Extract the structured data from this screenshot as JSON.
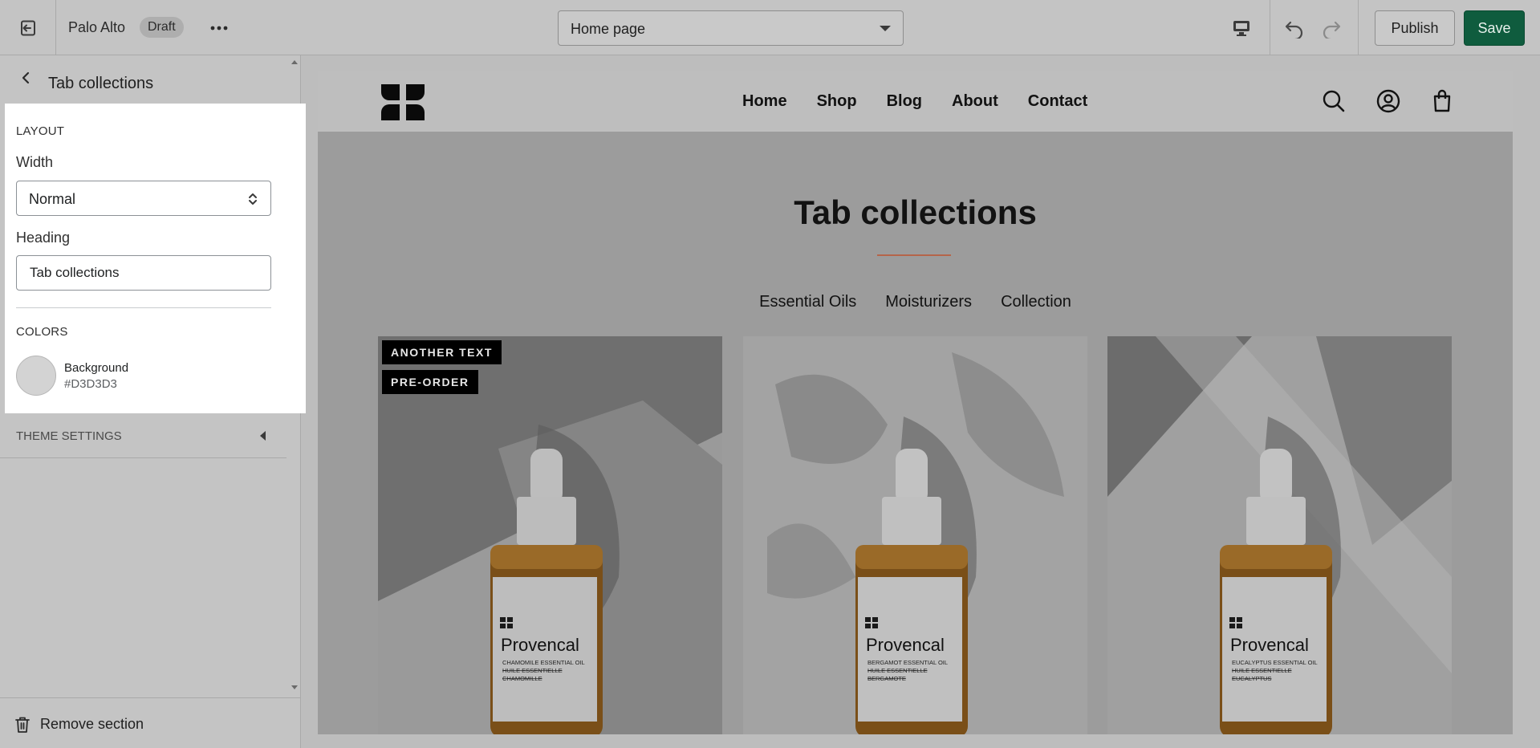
{
  "topbar": {
    "store_name": "Palo Alto",
    "status_badge": "Draft",
    "more_label": "•••",
    "page_selector": "Home page",
    "publish_label": "Publish",
    "save_label": "Save"
  },
  "sidebar": {
    "title": "Tab collections",
    "layout": {
      "section_label": "LAYOUT",
      "width_label": "Width",
      "width_value": "Normal",
      "heading_label": "Heading",
      "heading_value": "Tab collections"
    },
    "colors": {
      "section_label": "COLORS",
      "background_label": "Background",
      "background_value": "#D3D3D3"
    },
    "theme_settings_label": "THEME SETTINGS",
    "remove_label": "Remove section"
  },
  "preview": {
    "nav": [
      "Home",
      "Shop",
      "Blog",
      "About",
      "Contact"
    ],
    "section_title": "Tab collections",
    "tabs": [
      "Essential Oils",
      "Moisturizers",
      "Collection"
    ],
    "products": [
      {
        "brand": "Provencal",
        "line1": "CHAMOMILE ESSENTIAL OIL",
        "line2": "HUILE ESSENTIELLE",
        "line3": "CHAMOMILLE",
        "badges": [
          "ANOTHER TEXT",
          "PRE-ORDER"
        ]
      },
      {
        "brand": "Provencal",
        "line1": "BERGAMOT ESSENTIAL OIL",
        "line2": "HUILE ESSENTIELLE",
        "line3": "BERGAMOTE",
        "badges": []
      },
      {
        "brand": "Provencal",
        "line1": "EUCALYPTUS ESSENTIAL OIL",
        "line2": "HUILE ESSENTIELLE",
        "line3": "EUCALYPTUS",
        "badges": []
      }
    ]
  },
  "colors": {
    "save_button": "#0F5C3E",
    "title_rule": "#B5654A",
    "swatch": "#D3D3D3"
  },
  "icons": [
    "exit-icon",
    "more-icon",
    "desktop-icon",
    "undo-icon",
    "redo-icon",
    "back-arrow-icon",
    "select-arrows-icon",
    "collapse-caret-icon",
    "trash-icon",
    "search-icon",
    "account-icon",
    "cart-icon",
    "logo-icon"
  ]
}
